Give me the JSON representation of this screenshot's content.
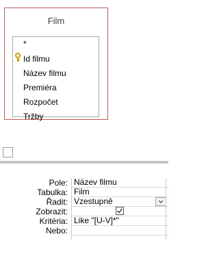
{
  "table": {
    "name": "Film",
    "fields": [
      "*",
      "Id filmu",
      "Název filmu",
      "Premiéra",
      "Rozpočet",
      "Tržby"
    ],
    "primary_key_field": "Id filmu"
  },
  "grid": {
    "labels": {
      "field": "Pole:",
      "table": "Tabulka:",
      "sort": "Řadit:",
      "show": "Zobrazit:",
      "criteria": "Kritéria:",
      "or": "Nebo:"
    },
    "values": {
      "field": "Název filmu",
      "table": "Film",
      "sort": "Vzestupně",
      "show": true,
      "criteria": "Like \"[U-V]*\"",
      "or": ""
    }
  },
  "icons": {
    "key": "key-icon",
    "dropdown": "chevron-down-icon",
    "checkbox": "checkmark-icon"
  },
  "colors": {
    "table_border": "#c05a5a",
    "key": "#c9a100"
  }
}
